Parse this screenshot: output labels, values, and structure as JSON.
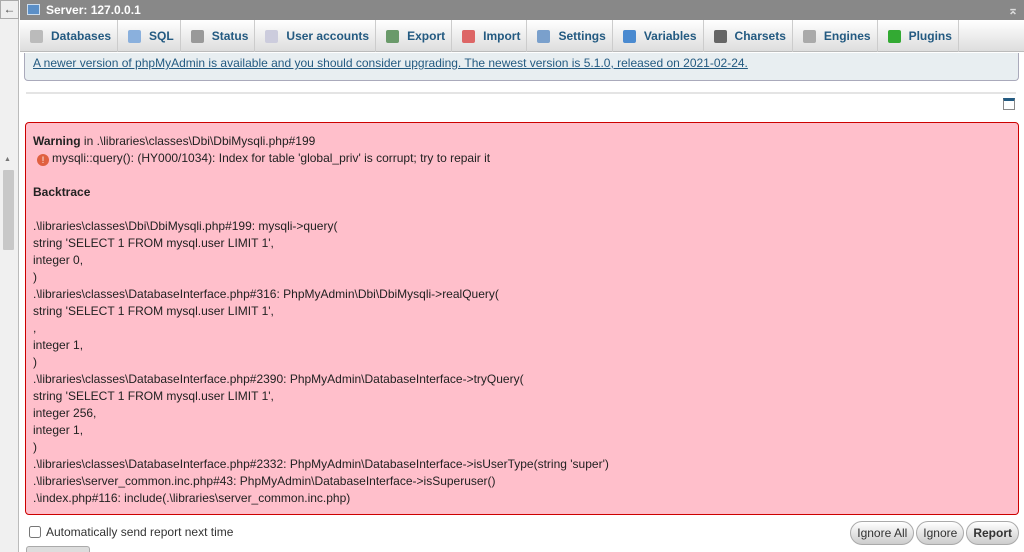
{
  "topbar": {
    "back": "←",
    "title": "Server: 127.0.0.1",
    "collapse": "⌅"
  },
  "tabs": [
    {
      "label": "Databases",
      "icon": "database-icon",
      "color": "#bbb"
    },
    {
      "label": "SQL",
      "icon": "sql-icon",
      "color": "#8ab0dd"
    },
    {
      "label": "Status",
      "icon": "status-icon",
      "color": "#999"
    },
    {
      "label": "User accounts",
      "icon": "user-accounts-icon",
      "color": "#ccd"
    },
    {
      "label": "Export",
      "icon": "export-icon",
      "color": "#6a9a6a"
    },
    {
      "label": "Import",
      "icon": "import-icon",
      "color": "#d66"
    },
    {
      "label": "Settings",
      "icon": "wrench-icon",
      "color": "#7aa0cc"
    },
    {
      "label": "Variables",
      "icon": "variables-icon",
      "color": "#4a8ad0"
    },
    {
      "label": "Charsets",
      "icon": "charsets-icon",
      "color": "#666"
    },
    {
      "label": "Engines",
      "icon": "engines-icon",
      "color": "#aaa"
    },
    {
      "label": "Plugins",
      "icon": "puzzle-icon",
      "color": "#3a3"
    }
  ],
  "notice": "A newer version of phpMyAdmin is available and you should consider upgrading. The newest version is 5.1.0, released on 2021-02-24.",
  "error": {
    "warning_label": "Warning",
    "warning_location": " in .\\libraries\\classes\\Dbi\\DbiMysqli.php#199",
    "message": "mysqli::query(): (HY000/1034): Index for table 'global_priv' is corrupt; try to repair it",
    "backtrace_title": "Backtrace",
    "lines": [
      ".\\libraries\\classes\\Dbi\\DbiMysqli.php#199: mysqli->query(",
      "string 'SELECT 1 FROM mysql.user LIMIT 1',",
      "integer 0,",
      ")",
      ".\\libraries\\classes\\DatabaseInterface.php#316: PhpMyAdmin\\Dbi\\DbiMysqli->realQuery(",
      "string 'SELECT 1 FROM mysql.user LIMIT 1',",
      ",",
      "integer 1,",
      ")",
      ".\\libraries\\classes\\DatabaseInterface.php#2390: PhpMyAdmin\\DatabaseInterface->tryQuery(",
      "string 'SELECT 1 FROM mysql.user LIMIT 1',",
      "integer 256,",
      "integer 1,",
      ")",
      ".\\libraries\\classes\\DatabaseInterface.php#2332: PhpMyAdmin\\DatabaseInterface->isUserType(string 'super')",
      ".\\libraries\\server_common.inc.php#43: PhpMyAdmin\\DatabaseInterface->isSuperuser()",
      ".\\index.php#116: include(.\\libraries\\server_common.inc.php)"
    ]
  },
  "footer": {
    "auto_send_label": "Automatically send report next time",
    "auto_send_checked": false,
    "ignore_all": "Ignore All",
    "ignore": "Ignore",
    "report": "Report"
  }
}
